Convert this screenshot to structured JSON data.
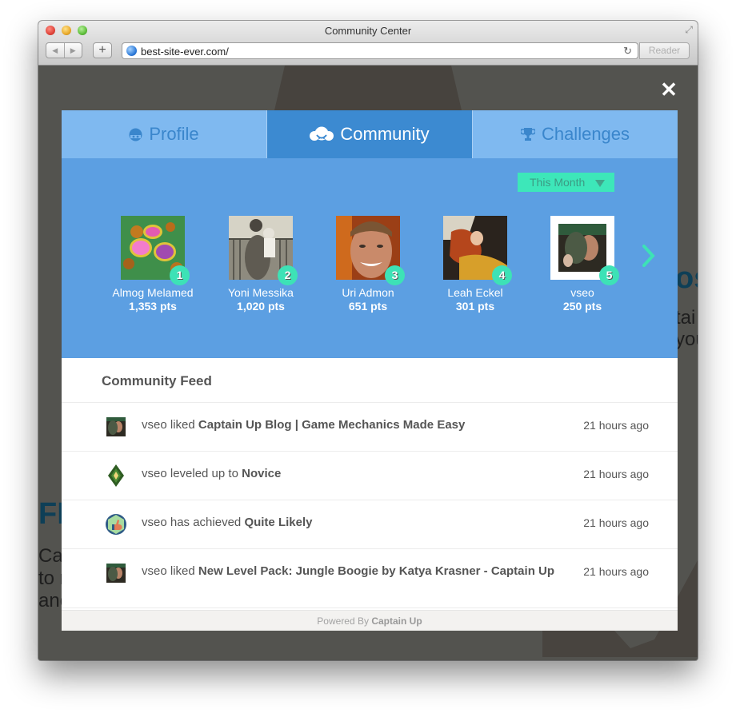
{
  "window": {
    "title": "Community Center",
    "url": "best-site-ever.com/",
    "reader_label": "Reader",
    "back_icon": "chevron-left-icon",
    "forward_icon": "chevron-right-icon",
    "add_tab_label": "+",
    "reload_icon": "reload-icon"
  },
  "background_page": {
    "heading_right": "os",
    "lines_right": [
      "tai",
      "you"
    ],
    "heading_left": "FL",
    "lines_left": [
      "Cap",
      "to r",
      "anc"
    ]
  },
  "modal": {
    "close_icon": "close-icon",
    "close_glyph": "✕",
    "tabs": [
      {
        "label": "Profile",
        "icon": "face-icon",
        "active": false
      },
      {
        "label": "Community",
        "icon": "community-icon",
        "active": true
      },
      {
        "label": "Challenges",
        "icon": "trophy-icon",
        "active": false
      }
    ],
    "period": {
      "selected": "This Month"
    },
    "colors": {
      "tab_bg": "#7fb9f0",
      "tab_active_bg": "#3c8ad1",
      "leaders_bg": "#5c9fe2",
      "accent": "#3de2b6"
    },
    "leaders": [
      {
        "rank": "1",
        "name": "Almog Melamed",
        "points": "1,353 pts"
      },
      {
        "rank": "2",
        "name": "Yoni Messika",
        "points": "1,020 pts"
      },
      {
        "rank": "3",
        "name": "Uri Admon",
        "points": "651 pts"
      },
      {
        "rank": "4",
        "name": "Leah Eckel",
        "points": "301 pts"
      },
      {
        "rank": "5",
        "name": "vseo",
        "points": "250 pts"
      }
    ],
    "feed": {
      "title": "Community Feed",
      "items": [
        {
          "icon": "user-avatar-icon",
          "user": "vseo",
          "action": "liked",
          "target": "Captain Up Blog | Game Mechanics Made Easy",
          "time": "21 hours ago"
        },
        {
          "icon": "level-badge-icon",
          "user": "vseo",
          "action": "leveled up to",
          "target": "Novice",
          "time": "21 hours ago"
        },
        {
          "icon": "achievement-badge-icon",
          "user": "vseo",
          "action": "has achieved",
          "target": "Quite Likely",
          "time": "21 hours ago"
        },
        {
          "icon": "user-avatar-icon",
          "user": "vseo",
          "action": "liked",
          "target": "New Level Pack: Jungle Boogie by Katya Krasner - Captain Up",
          "time": "21 hours ago"
        }
      ]
    },
    "footer": {
      "prefix": "Powered By",
      "brand": "Captain Up"
    }
  }
}
